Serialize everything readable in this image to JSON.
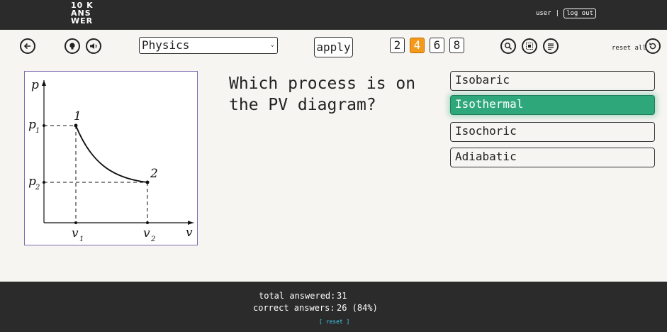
{
  "header": {
    "logo_lines": [
      "10 K",
      "ANS",
      "WER"
    ],
    "user": "user",
    "separator": "|",
    "logout": "log out"
  },
  "toolbar": {
    "subject": "Physics",
    "apply_label": "apply",
    "counts": [
      "2",
      "4",
      "6",
      "8"
    ],
    "active_count": "4",
    "reset_all_label": "reset all"
  },
  "question": {
    "text": "Which process is on the PV diagram?",
    "diagram": {
      "y_axis": "p",
      "x_axis": "v",
      "p1": "p",
      "p1_sub": "1",
      "p2": "p",
      "p2_sub": "2",
      "v1": "v",
      "v1_sub": "1",
      "v2": "v",
      "v2_sub": "2",
      "point1": "1",
      "point2": "2"
    }
  },
  "options": [
    {
      "label": "Isobaric",
      "selected": false
    },
    {
      "label": "Isothermal",
      "selected": true
    },
    {
      "label": "Isochoric",
      "selected": false
    },
    {
      "label": "Adiabatic",
      "selected": false
    }
  ],
  "footer": {
    "total_label": "total answered:",
    "total_value": "31",
    "correct_label": "correct answers:",
    "correct_value": "26 (84%)",
    "reset_label": "[ reset ]"
  },
  "colors": {
    "selected_option": "#2ea87a",
    "active_count": "#f39a1d",
    "diagram_border": "#7d6bb0",
    "reset_link": "#3ecfef"
  },
  "icons": [
    "back-arrow-icon",
    "lightbulb-icon",
    "speaker-icon",
    "zoom-icon",
    "grid-icon",
    "text-lines-icon",
    "reset-icon"
  ]
}
